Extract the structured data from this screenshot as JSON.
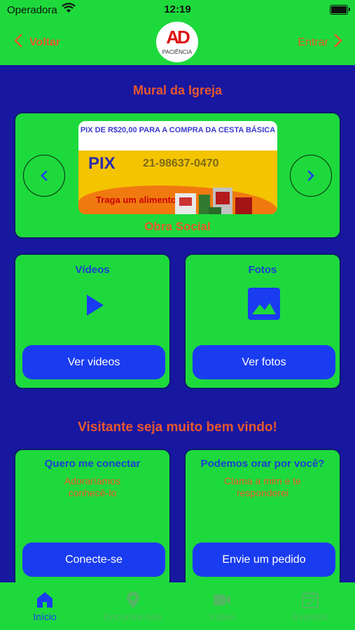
{
  "status_bar": {
    "carrier": "Operadora",
    "time": "12:19"
  },
  "nav": {
    "back_label": "Voltar",
    "enter_label": "Entrar",
    "logo_text": "AD",
    "logo_subtext": "PACIÊNCIA"
  },
  "mural": {
    "title": "Mural da Igreja",
    "banner": {
      "headline": "PIX DE R$20,00 PARA A COMPRA DA CESTA BÁSICA",
      "pix_label": "PIX",
      "phone": "21-98637-0470",
      "footer_text": "Traga um alimento não"
    },
    "caption": "Obra Social"
  },
  "media": {
    "videos": {
      "title": "Vídeos",
      "button": "Ver videos"
    },
    "photos": {
      "title": "Fotos",
      "button": "Ver fotos"
    }
  },
  "welcome": {
    "title": "Visitante seja muito bem vindo!"
  },
  "connect": {
    "title": "Quero me conectar",
    "desc": "Adoraríamos conhecê-lo",
    "button": "Conecte-se"
  },
  "prayer": {
    "title": "Podemos orar por você?",
    "desc": "Clama a mim e te responderei",
    "button": "Envie um pedido"
  },
  "tabbar": {
    "tabs": [
      {
        "label": "Início",
        "icon": "home-icon",
        "active": true
      },
      {
        "label": "Encontre-nos",
        "icon": "location-pin-icon",
        "active": false
      },
      {
        "label": "Vídeo",
        "icon": "video-camera-icon",
        "active": false
      },
      {
        "label": "Eventos",
        "icon": "calendar-icon",
        "active": false
      }
    ]
  },
  "colors": {
    "green": "#1ed93c",
    "navy": "#1717a0",
    "orange": "#e8582d",
    "blue": "#1a3cf0",
    "inactive_tab": "#4fb75f"
  }
}
